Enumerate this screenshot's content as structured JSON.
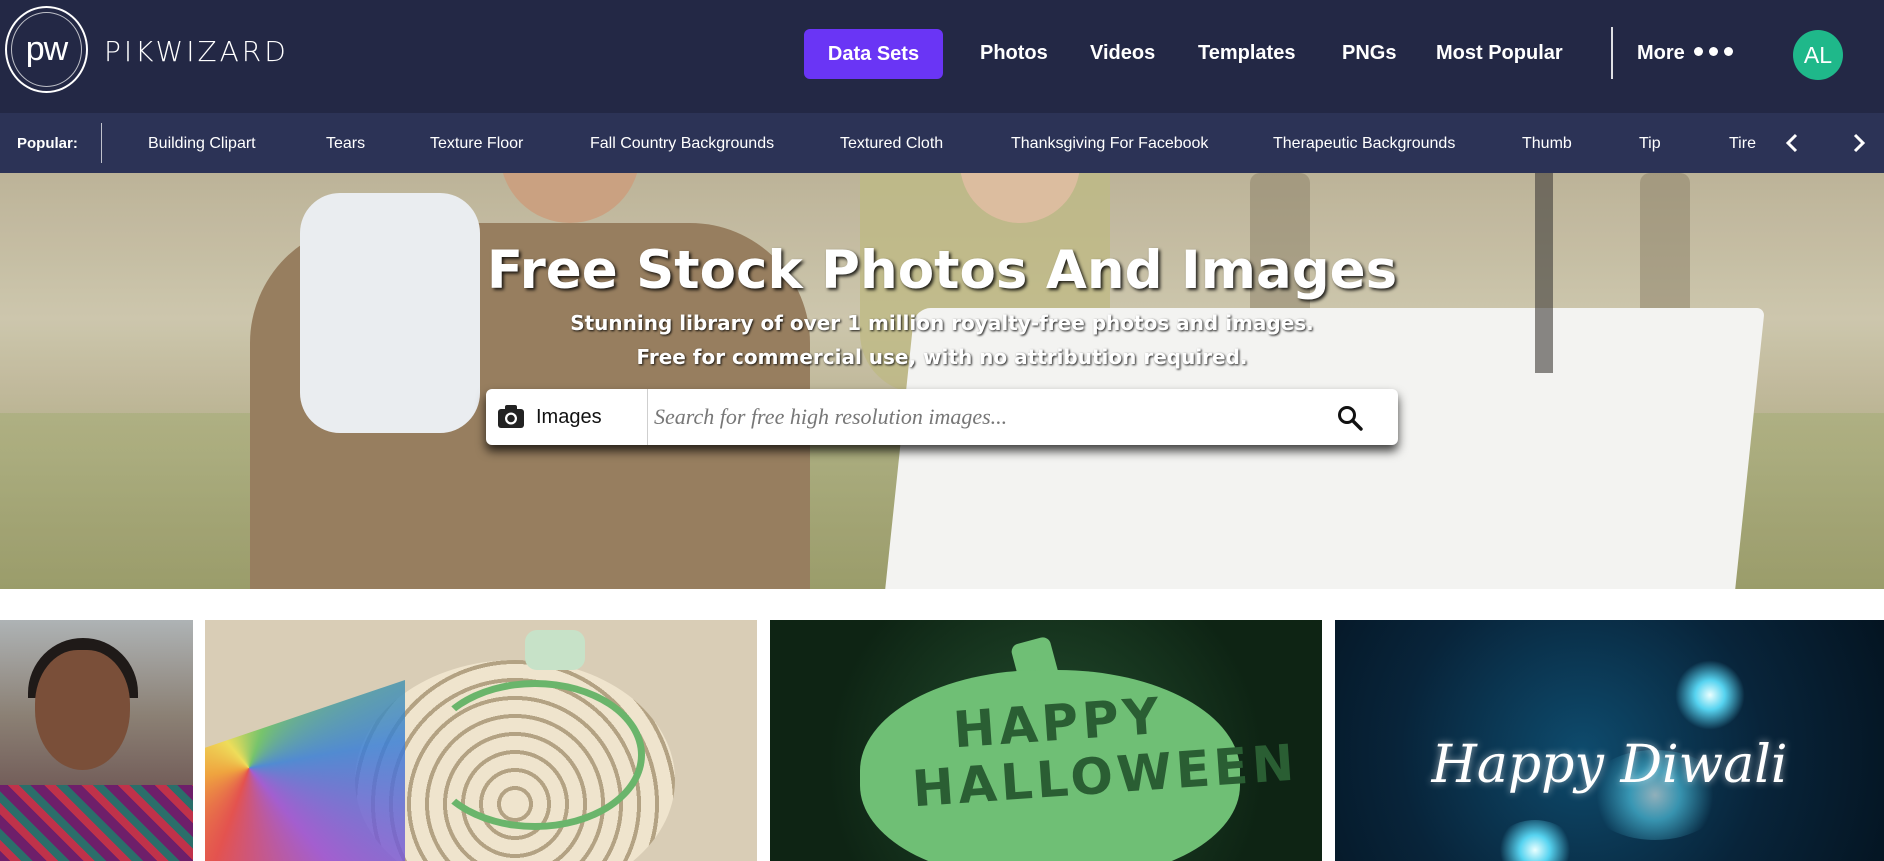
{
  "header": {
    "logo_mark": "pw",
    "logo_text": "PIKWIZARD",
    "nav": {
      "data_sets": "Data Sets",
      "photos": "Photos",
      "videos": "Videos",
      "templates": "Templates",
      "pngs": "PNGs",
      "most_popular": "Most Popular",
      "more": "More"
    },
    "avatar_initials": "AL",
    "accent_color": "#6a35f5",
    "avatar_color": "#1fb88a"
  },
  "popular": {
    "label": "Popular:",
    "items": [
      "Building Clipart",
      "Tears",
      "Texture Floor",
      "Fall Country Backgrounds",
      "Textured Cloth",
      "Thanksgiving For Facebook",
      "Therapeutic Backgrounds",
      "Thumb",
      "Tip",
      "Tire"
    ],
    "prev_icon": "chevron-left-icon",
    "next_icon": "chevron-right-icon"
  },
  "hero": {
    "title": "Free Stock Photos And Images",
    "subtitle_line1": "Stunning library of over 1 million royalty-free photos and images.",
    "subtitle_line2": "Free for commercial use, with no attribution required."
  },
  "search": {
    "type_label": "Images",
    "type_icon": "camera-icon",
    "placeholder": "Search for free high resolution images...",
    "value": "",
    "submit_icon": "search-icon"
  },
  "gallery": {
    "tile3_text": "HAPPY HALLOWEEN",
    "tile4_text": "Happy Diwali"
  }
}
